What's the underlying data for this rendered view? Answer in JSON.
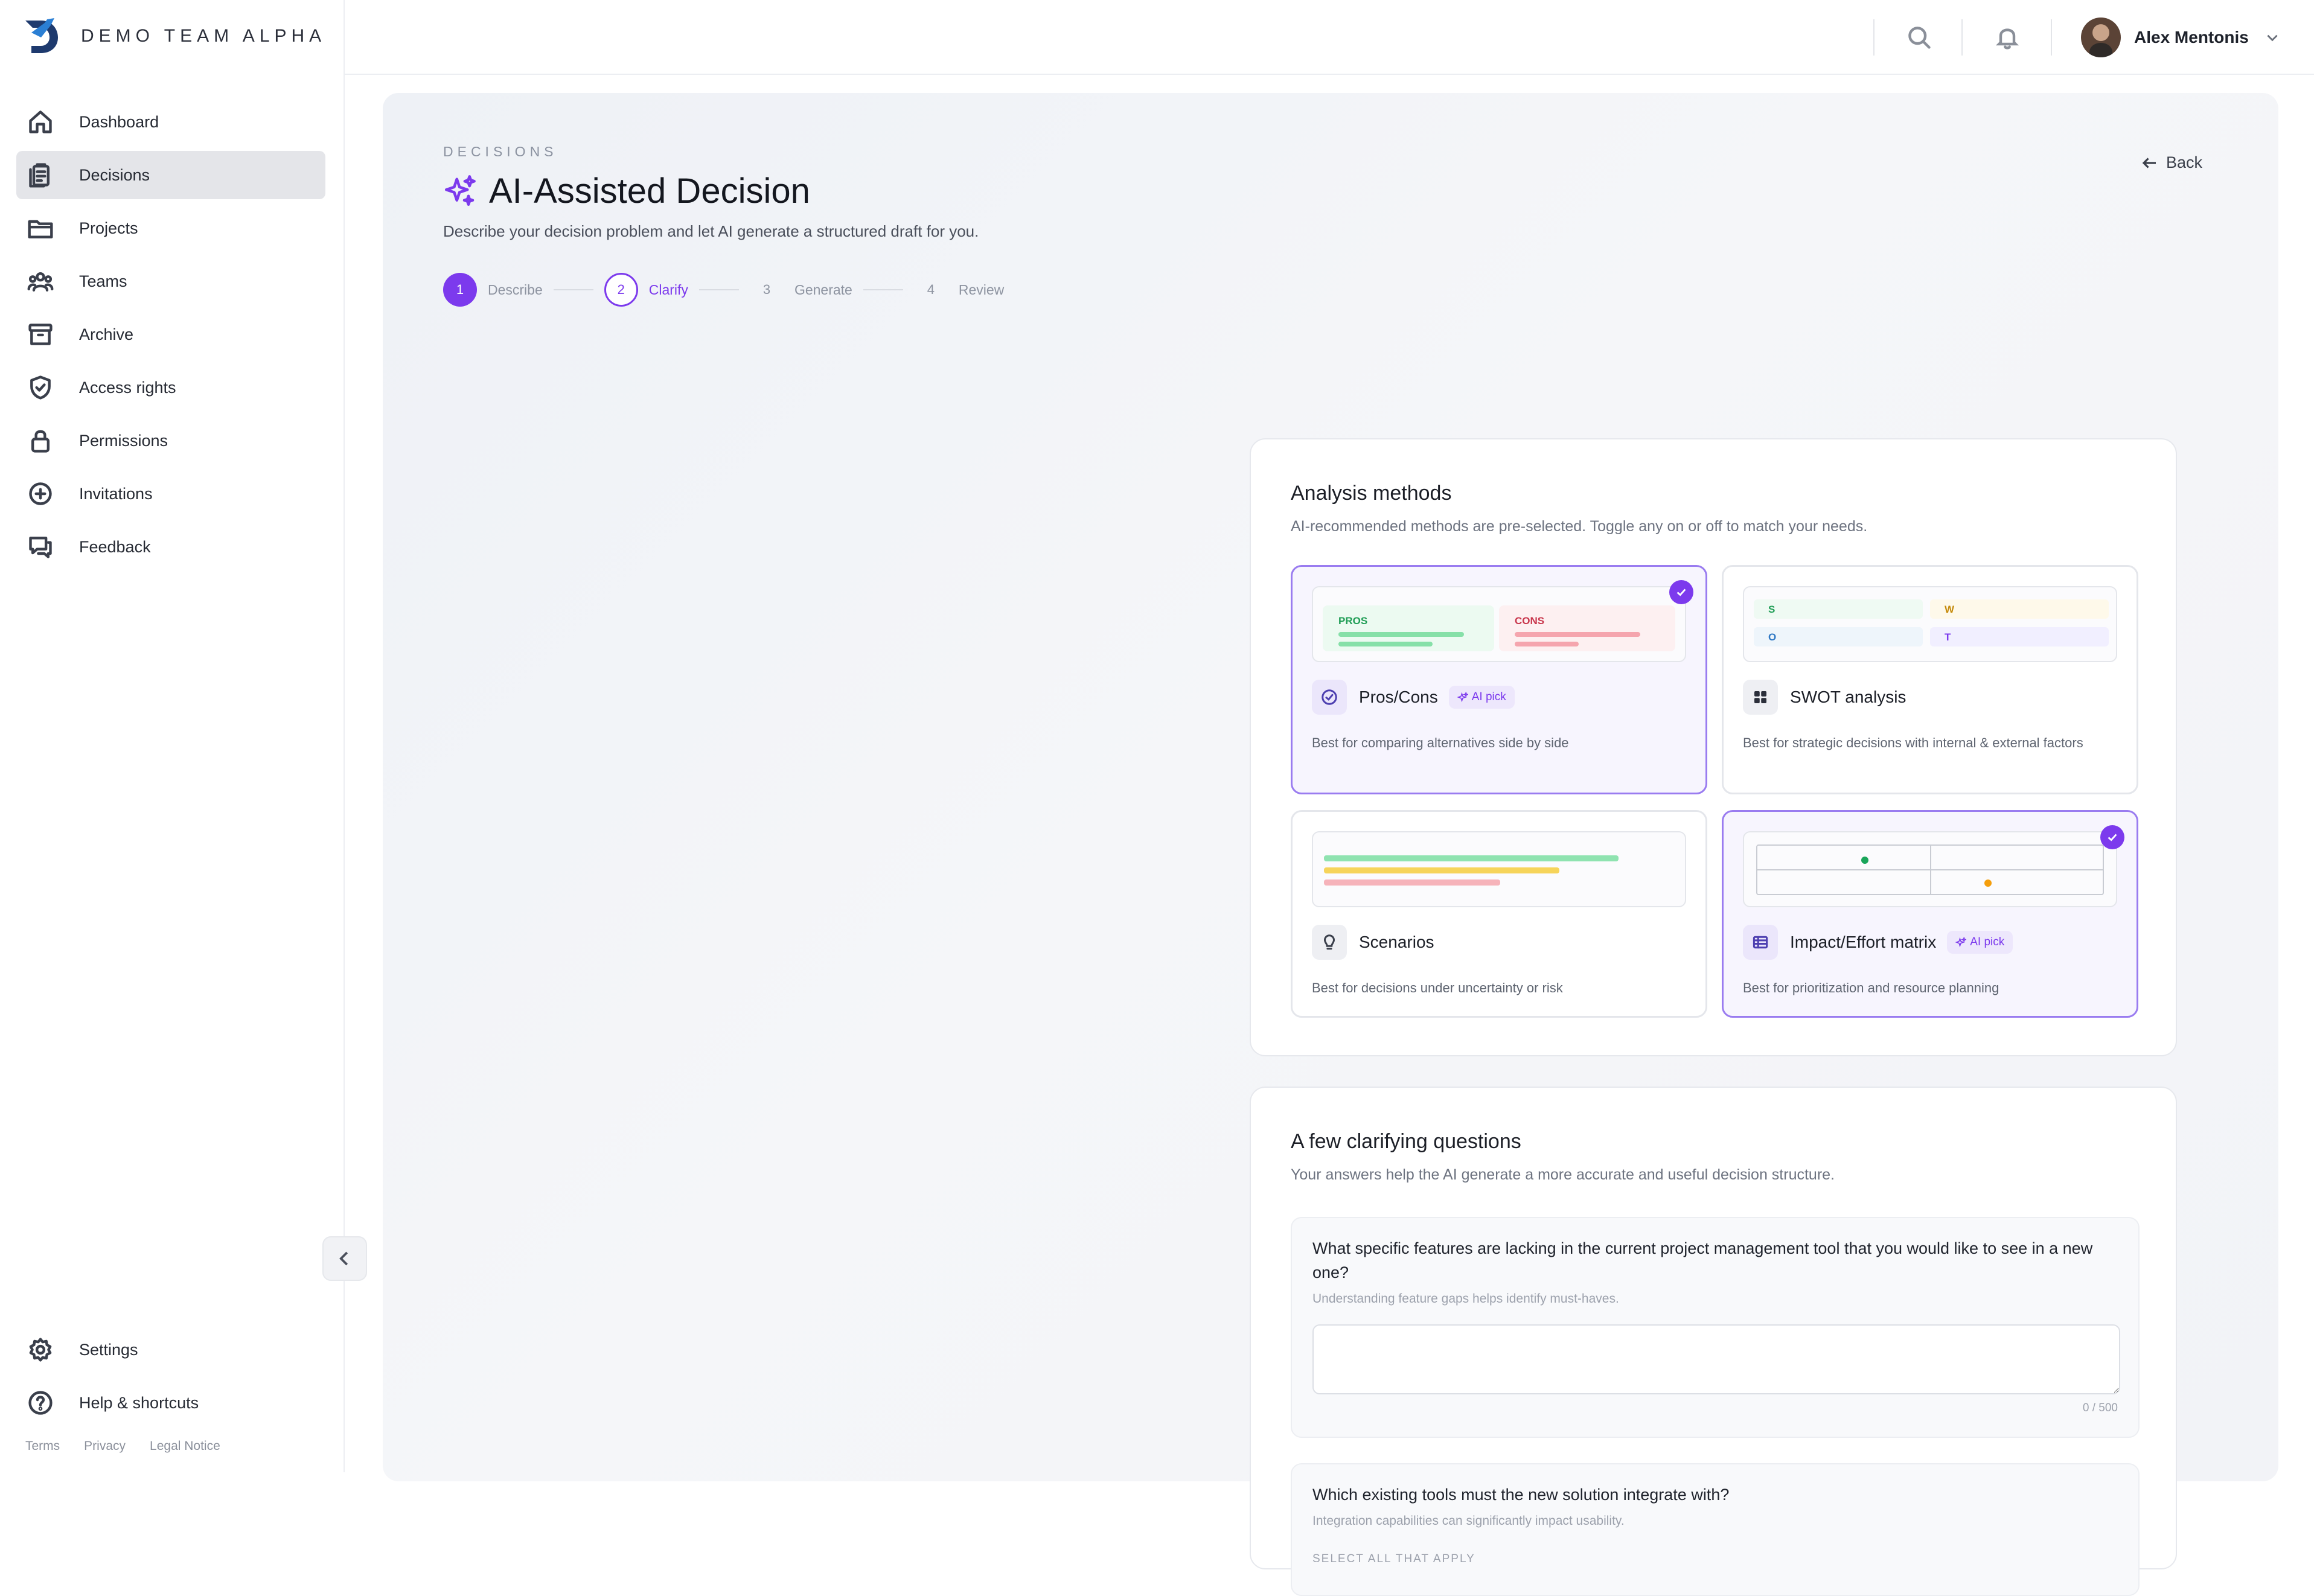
{
  "brand": {
    "name": "DEMO TEAM ALPHA"
  },
  "sidebar": {
    "items": [
      {
        "label": "Dashboard",
        "icon": "home-icon"
      },
      {
        "label": "Decisions",
        "icon": "clipboard-icon",
        "active": true
      },
      {
        "label": "Projects",
        "icon": "folder-icon"
      },
      {
        "label": "Teams",
        "icon": "users-icon"
      },
      {
        "label": "Archive",
        "icon": "archive-icon"
      },
      {
        "label": "Access rights",
        "icon": "shield-icon"
      },
      {
        "label": "Permissions",
        "icon": "lock-icon"
      },
      {
        "label": "Invitations",
        "icon": "plus-circle-icon"
      },
      {
        "label": "Feedback",
        "icon": "chat-icon"
      }
    ],
    "bottom": [
      {
        "label": "Settings",
        "icon": "gear-icon"
      },
      {
        "label": "Help & shortcuts",
        "icon": "help-icon"
      }
    ],
    "legal": [
      "Terms",
      "Privacy",
      "Legal Notice"
    ]
  },
  "topbar": {
    "user_name": "Alex Mentonis"
  },
  "page": {
    "breadcrumb": "DECISIONS",
    "title": "AI-Assisted Decision",
    "subtitle": "Describe your decision problem and let AI generate a structured draft for you.",
    "back_label": "Back"
  },
  "stepper": [
    {
      "num": "1",
      "label": "Describe",
      "state": "done"
    },
    {
      "num": "2",
      "label": "Clarify",
      "state": "current"
    },
    {
      "num": "3",
      "label": "Generate",
      "state": "upcoming"
    },
    {
      "num": "4",
      "label": "Review",
      "state": "upcoming"
    }
  ],
  "methods_card": {
    "title": "Analysis methods",
    "subtitle": "AI-recommended methods are pre-selected. Toggle any on or off to match your needs.",
    "ai_pick_label": "AI pick",
    "methods": [
      {
        "name": "Pros/Cons",
        "desc": "Best for comparing alternatives side by side",
        "selected": true,
        "ai_pick": true,
        "preview": {
          "pros": "PROS",
          "cons": "CONS"
        }
      },
      {
        "name": "SWOT analysis",
        "desc": "Best for strategic decisions with internal & external factors",
        "selected": false,
        "ai_pick": false,
        "preview": {
          "s": "S",
          "w": "W",
          "o": "O",
          "t": "T"
        }
      },
      {
        "name": "Scenarios",
        "desc": "Best for decisions under uncertainty or risk",
        "selected": false,
        "ai_pick": false
      },
      {
        "name": "Impact/Effort matrix",
        "desc": "Best for prioritization and resource planning",
        "selected": true,
        "ai_pick": true
      }
    ]
  },
  "questions_card": {
    "title": "A few clarifying questions",
    "subtitle": "Your answers help the AI generate a more accurate and useful decision structure.",
    "questions": [
      {
        "text": "What specific features are lacking in the current project management tool that you would like to see in a new one?",
        "hint": "Understanding feature gaps helps identify must-haves.",
        "value": "",
        "counter": "0 / 500"
      },
      {
        "text": "Which existing tools must the new solution integrate with?",
        "hint": "Integration capabilities can significantly impact usability.",
        "select_label": "SELECT ALL THAT APPLY"
      }
    ]
  },
  "colors": {
    "accent": "#7c3aed",
    "accent_light": "#ede7fc",
    "selected_border": "#9a7cf0"
  }
}
